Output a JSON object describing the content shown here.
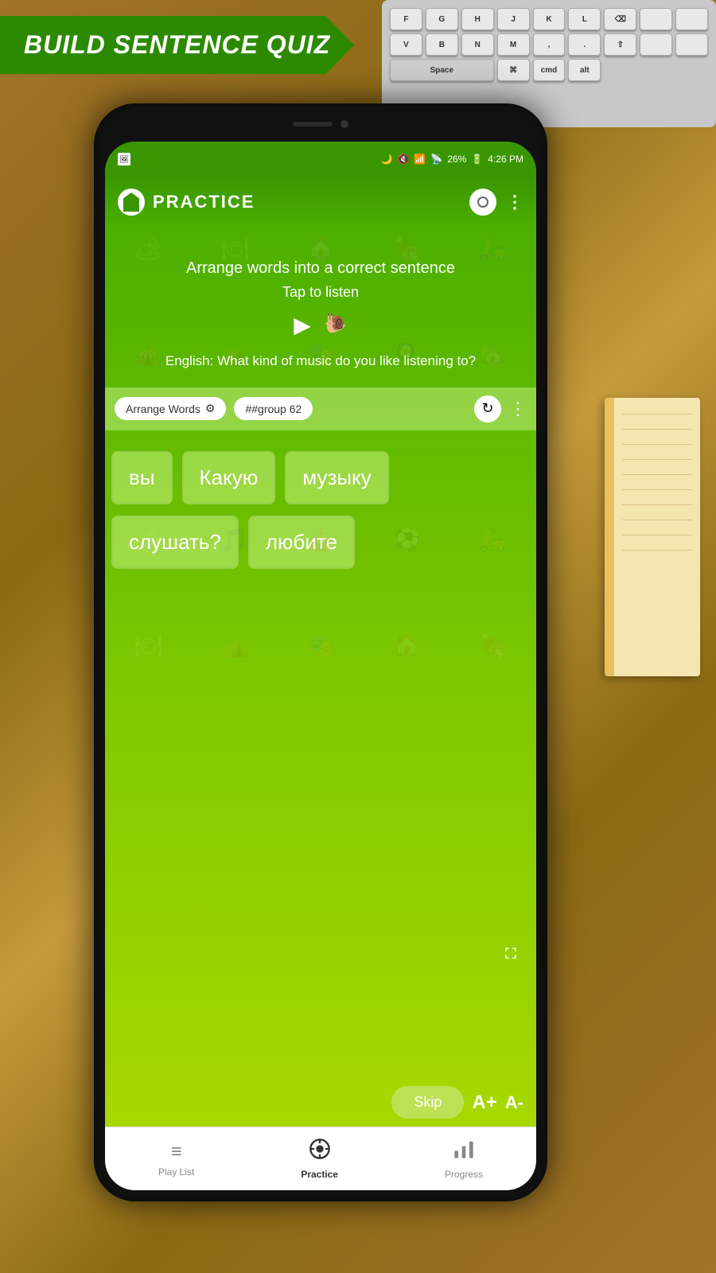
{
  "banner": {
    "text": "BUILD SENTENCE QUIZ"
  },
  "status_bar": {
    "time": "4:26 PM",
    "battery": "26%",
    "battery_icon": "🔋"
  },
  "top_bar": {
    "title": "PRACTICE",
    "more_icon": "⋮"
  },
  "instruction": {
    "main": "Arrange words into a correct sentence",
    "tap_listen": "Tap to listen",
    "english_label": "English:",
    "english_sentence": "What kind of music do you like listening to?"
  },
  "tags": {
    "arrange_words": "Arrange Words",
    "group": "##group 62"
  },
  "words": [
    {
      "id": 1,
      "text": "вы",
      "row": 1
    },
    {
      "id": 2,
      "text": "Какую",
      "row": 1
    },
    {
      "id": 3,
      "text": "музыку",
      "row": 1
    },
    {
      "id": 4,
      "text": "слушать?",
      "row": 2
    },
    {
      "id": 5,
      "text": "любите",
      "row": 2
    }
  ],
  "bottom": {
    "skip_label": "Skip",
    "font_plus": "A+",
    "font_minus": "A-"
  },
  "nav": {
    "items": [
      {
        "id": "playlist",
        "label": "Play List",
        "icon": "≡",
        "active": false
      },
      {
        "id": "practice",
        "label": "Practice",
        "icon": "⚙",
        "active": true
      },
      {
        "id": "progress",
        "label": "Progress",
        "icon": "📊",
        "active": false
      }
    ]
  },
  "bg_icons": [
    "🍽",
    "🏕",
    "🍖",
    "🛵",
    "🏠",
    "⚽",
    "🎵",
    "🎪",
    "🎭"
  ]
}
